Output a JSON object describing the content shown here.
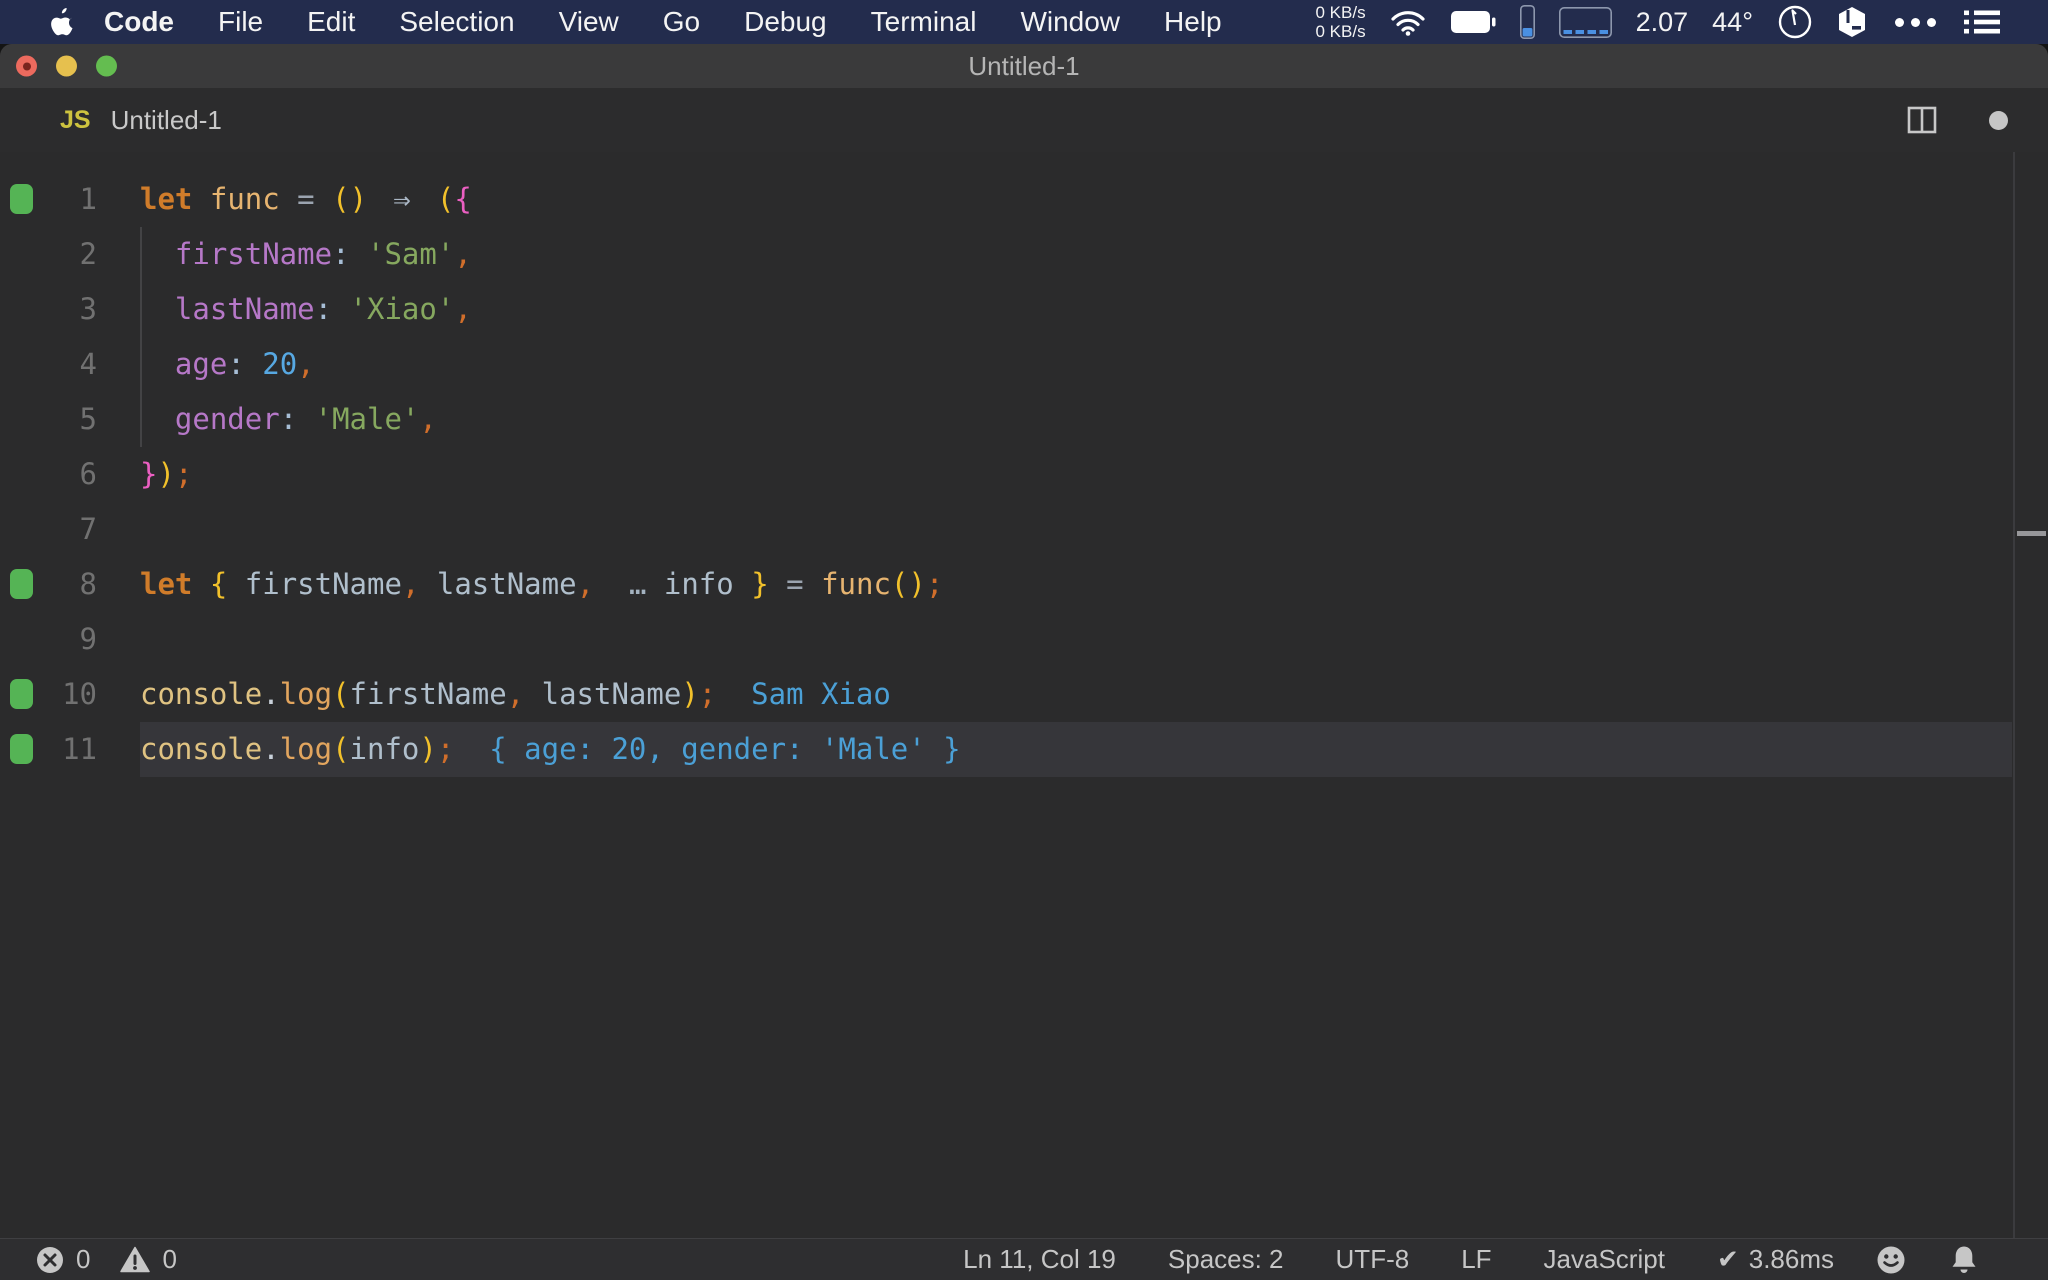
{
  "menu_bar": {
    "items": [
      {
        "label": "Code",
        "bold": true
      },
      {
        "label": "File"
      },
      {
        "label": "Edit"
      },
      {
        "label": "Selection"
      },
      {
        "label": "View"
      },
      {
        "label": "Go"
      },
      {
        "label": "Debug"
      },
      {
        "label": "Terminal"
      },
      {
        "label": "Window"
      },
      {
        "label": "Help"
      }
    ],
    "status": {
      "net_up": "0 KB/s",
      "net_down": "0 KB/s",
      "cpu_value": "2.07",
      "temperature": "44°"
    }
  },
  "window": {
    "title": "Untitled-1"
  },
  "tab": {
    "file_type": "JS",
    "label": "Untitled-1"
  },
  "editor": {
    "lines": [
      {
        "n": 1,
        "mark": true,
        "tokens": [
          {
            "c": "kw",
            "t": "let"
          },
          {
            "c": "pl",
            "t": " "
          },
          {
            "c": "fn",
            "t": "func"
          },
          {
            "c": "pl",
            "t": " "
          },
          {
            "c": "op",
            "t": "="
          },
          {
            "c": "pl",
            "t": " "
          },
          {
            "c": "b1",
            "t": "()"
          },
          {
            "c": "pl",
            "t": " "
          },
          {
            "c": "ar",
            "t": "⇒"
          },
          {
            "c": "pl",
            "t": " "
          },
          {
            "c": "b1",
            "t": "("
          },
          {
            "c": "b2",
            "t": "{"
          }
        ]
      },
      {
        "n": 2,
        "guide": true,
        "tokens": [
          {
            "c": "pl",
            "t": "  "
          },
          {
            "c": "pr",
            "t": "firstName"
          },
          {
            "c": "co",
            "t": ":"
          },
          {
            "c": "pl",
            "t": " "
          },
          {
            "c": "st",
            "t": "'Sam'"
          },
          {
            "c": "pu",
            "t": ","
          }
        ]
      },
      {
        "n": 3,
        "guide": true,
        "tokens": [
          {
            "c": "pl",
            "t": "  "
          },
          {
            "c": "pr",
            "t": "lastName"
          },
          {
            "c": "co",
            "t": ":"
          },
          {
            "c": "pl",
            "t": " "
          },
          {
            "c": "st",
            "t": "'Xiao'"
          },
          {
            "c": "pu",
            "t": ","
          }
        ]
      },
      {
        "n": 4,
        "guide": true,
        "tokens": [
          {
            "c": "pl",
            "t": "  "
          },
          {
            "c": "pr",
            "t": "age"
          },
          {
            "c": "co",
            "t": ":"
          },
          {
            "c": "pl",
            "t": " "
          },
          {
            "c": "nu",
            "t": "20"
          },
          {
            "c": "pu",
            "t": ","
          }
        ]
      },
      {
        "n": 5,
        "guide": true,
        "tokens": [
          {
            "c": "pl",
            "t": "  "
          },
          {
            "c": "pr",
            "t": "gender"
          },
          {
            "c": "co",
            "t": ":"
          },
          {
            "c": "pl",
            "t": " "
          },
          {
            "c": "st",
            "t": "'Male'"
          },
          {
            "c": "pu",
            "t": ","
          }
        ]
      },
      {
        "n": 6,
        "tokens": [
          {
            "c": "b2",
            "t": "}"
          },
          {
            "c": "b1",
            "t": ")"
          },
          {
            "c": "pu",
            "t": ";"
          }
        ]
      },
      {
        "n": 7,
        "tokens": []
      },
      {
        "n": 8,
        "mark": true,
        "tokens": [
          {
            "c": "kw",
            "t": "let"
          },
          {
            "c": "pl",
            "t": " "
          },
          {
            "c": "b1",
            "t": "{"
          },
          {
            "c": "pl",
            "t": " "
          },
          {
            "c": "vr",
            "t": "firstName"
          },
          {
            "c": "pu",
            "t": ","
          },
          {
            "c": "pl",
            "t": " "
          },
          {
            "c": "vr",
            "t": "lastName"
          },
          {
            "c": "pu",
            "t": ","
          },
          {
            "c": "pl",
            "t": " "
          },
          {
            "c": "sp",
            "t": "…"
          },
          {
            "c": "vr",
            "t": "info"
          },
          {
            "c": "pl",
            "t": " "
          },
          {
            "c": "b1",
            "t": "}"
          },
          {
            "c": "pl",
            "t": " "
          },
          {
            "c": "op",
            "t": "="
          },
          {
            "c": "pl",
            "t": " "
          },
          {
            "c": "fn",
            "t": "func"
          },
          {
            "c": "b1",
            "t": "()"
          },
          {
            "c": "pu",
            "t": ";"
          }
        ]
      },
      {
        "n": 9,
        "tokens": []
      },
      {
        "n": 10,
        "mark": true,
        "output": "Sam Xiao",
        "tokens": [
          {
            "c": "cs",
            "t": "console"
          },
          {
            "c": "dt",
            "t": "."
          },
          {
            "c": "lg",
            "t": "log"
          },
          {
            "c": "b1",
            "t": "("
          },
          {
            "c": "vr",
            "t": "firstName"
          },
          {
            "c": "pu",
            "t": ","
          },
          {
            "c": "pl",
            "t": " "
          },
          {
            "c": "vr",
            "t": "lastName"
          },
          {
            "c": "b1",
            "t": ")"
          },
          {
            "c": "pu",
            "t": ";"
          }
        ]
      },
      {
        "n": 11,
        "mark": true,
        "current": true,
        "output": "{ age: 20, gender: 'Male' }",
        "tokens": [
          {
            "c": "cs",
            "t": "console"
          },
          {
            "c": "dt",
            "t": "."
          },
          {
            "c": "lg",
            "t": "log"
          },
          {
            "c": "b1",
            "t": "("
          },
          {
            "c": "vr",
            "t": "info"
          },
          {
            "c": "b1",
            "t": ")"
          },
          {
            "c": "pu",
            "t": ";"
          }
        ]
      }
    ]
  },
  "status_bar": {
    "errors": "0",
    "warnings": "0",
    "cursor": "Ln 11, Col 19",
    "indent": "Spaces: 2",
    "encoding": "UTF-8",
    "eol": "LF",
    "language": "JavaScript",
    "perf_check": "✔",
    "perf": "3.86ms"
  },
  "colors": {
    "desktop_bg": "#141414",
    "menubar_bg": "#232c4d",
    "titlebar_bg": "#3a3a3b",
    "tabbar_bg": "#2c2c2d",
    "editor_bg": "#2b2b2c",
    "statusbar_bg": "#2e2e30",
    "line_highlight": "#36363a",
    "gutter_mark": "#55b455",
    "line_number": "#717171",
    "indent_guide": "#434345",
    "traffic_red": "#ec6a5e",
    "traffic_red_dot": "#7a241e",
    "traffic_yellow": "#e6c04e",
    "traffic_green": "#64bd50",
    "blue_accent": "#4a90e2",
    "js_icon": "#cdc33f",
    "ui_text": "#c6c6c6",
    "tok_keyword": "#d07c2a",
    "tok_func": "#e7b470",
    "tok_operator": "#9ba4b0",
    "tok_arrow": "#abb8c6",
    "tok_bracket1": "#f2c12b",
    "tok_bracket2": "#eb5fc2",
    "tok_property": "#b678c8",
    "tok_colon": "#a7bed6",
    "tok_string": "#86a85f",
    "tok_punct": "#d06e2b",
    "tok_number": "#57a8e2",
    "tok_variable": "#b0bfcc",
    "tok_spread": "#a3b2c0",
    "tok_console": "#e0c382",
    "tok_dot": "#c9d1da",
    "tok_log": "#e2a55e",
    "inline_output": "#4ba0d6"
  }
}
